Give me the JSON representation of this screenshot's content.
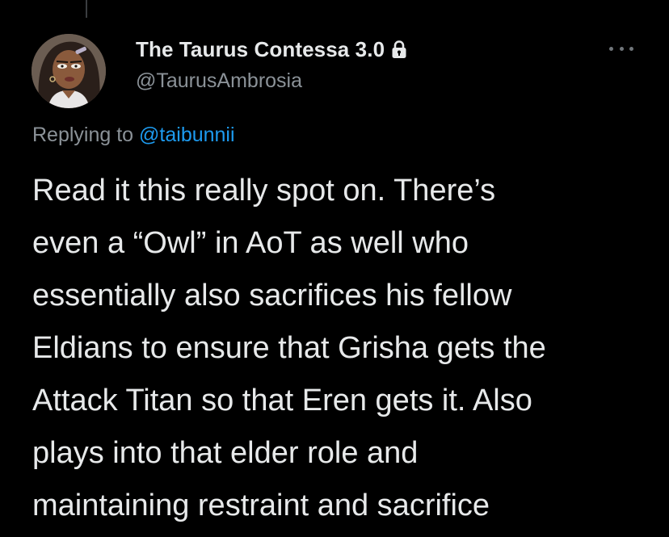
{
  "author": {
    "display_name": "The Taurus Contessa 3.0",
    "handle": "@TaurusAmbrosia",
    "protected_icon": "lock-icon",
    "avatar_icon": "avatar-illustration"
  },
  "menu": {
    "icon": "more-horizontal-icon"
  },
  "reply_context": {
    "prefix": "Replying to",
    "mention": "@taibunnii"
  },
  "tweet": {
    "lines": [
      "Read it this really spot on. There’s",
      "even a “Owl” in AoT as well who",
      "essentially also sacrifices his fellow",
      "Eldians to ensure that Grisha gets the",
      "Attack Titan so that Eren gets it. Also",
      "plays into that elder role and",
      "maintaining restraint and sacrifice"
    ]
  },
  "colors": {
    "background": "#000000",
    "primary_text": "#e7e9ea",
    "secondary_text": "#8b9298",
    "link": "#1d9bf0"
  }
}
